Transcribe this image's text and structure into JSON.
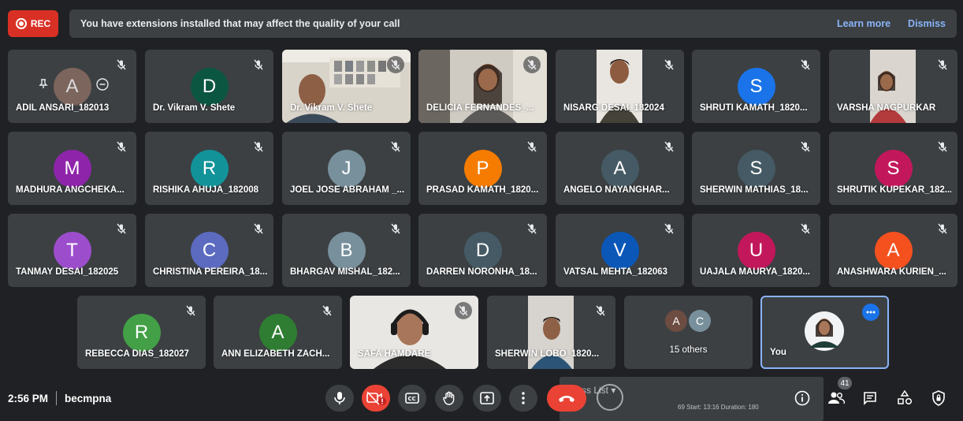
{
  "banner": {
    "rec_label": "REC",
    "message": "You have extensions installed that may affect the quality of your call",
    "learn_more": "Learn more",
    "dismiss": "Dismiss"
  },
  "participants": {
    "adil": {
      "name": "ADIL ANSARI_182013",
      "initial": "A"
    },
    "vikram_d": {
      "name": "Dr. Vikram V. Shete",
      "initial": "D"
    },
    "vikram_v": {
      "name": "Dr. Vikram V. Shete"
    },
    "delicia": {
      "name": "DELICIA FERNANDES_..."
    },
    "nisarg": {
      "name": "NISARG DESAI_182024"
    },
    "shruti": {
      "name": "SHRUTI KAMATH_1820...",
      "initial": "S"
    },
    "varsha": {
      "name": "VARSHA NAGPURKAR"
    },
    "madhura": {
      "name": "MADHURA ANGCHEKA...",
      "initial": "M"
    },
    "rishika": {
      "name": "RISHIKA AHUJA_182008",
      "initial": "R"
    },
    "joel": {
      "name": "JOEL JOSE ABRAHAM _...",
      "initial": "J"
    },
    "prasad": {
      "name": "PRASAD KAMATH_1820...",
      "initial": "P"
    },
    "angelo": {
      "name": "ANGELO NAYANGHAR...",
      "initial": "A"
    },
    "sherwin_m": {
      "name": "SHERWIN MATHIAS_18...",
      "initial": "S"
    },
    "shrutik": {
      "name": "SHRUTIK KUPEKAR_182...",
      "initial": "S"
    },
    "tanmay": {
      "name": "TANMAY DESAI_182025",
      "initial": "T"
    },
    "christina": {
      "name": "CHRISTINA PEREIRA_18...",
      "initial": "C"
    },
    "bhargav": {
      "name": "BHARGAV MISHAL_182...",
      "initial": "B"
    },
    "darren": {
      "name": "DARREN NORONHA_18...",
      "initial": "D"
    },
    "vatsal": {
      "name": "VATSAL MEHTA_182063",
      "initial": "V"
    },
    "uajala": {
      "name": "UAJALA MAURYA_1820...",
      "initial": "U"
    },
    "anashwara": {
      "name": "ANASHWARA KURIEN_...",
      "initial": "A"
    },
    "rebecca": {
      "name": "REBECCA DIAS_182027",
      "initial": "R"
    },
    "ann": {
      "name": "ANN ELIZABETH ZACH...",
      "initial": "A"
    },
    "safa": {
      "name": "SAFA HAMDARE"
    },
    "sherwin_l": {
      "name": "SHERWIN LOBO_1820..."
    },
    "others": {
      "label": "15 others",
      "initial_a": "A",
      "initial_c": "C"
    },
    "you": {
      "name": "You"
    }
  },
  "bottom": {
    "time": "2:56 PM",
    "meeting_code": "becmpna",
    "participant_count": "41",
    "class_list": "Class List",
    "overlay_status": "69 Start: 13:16 Duration: 180"
  },
  "colors": {
    "tile": "#3c4043",
    "background": "#202124",
    "accent": "#8ab4f8",
    "hangup": "#ea4335"
  }
}
